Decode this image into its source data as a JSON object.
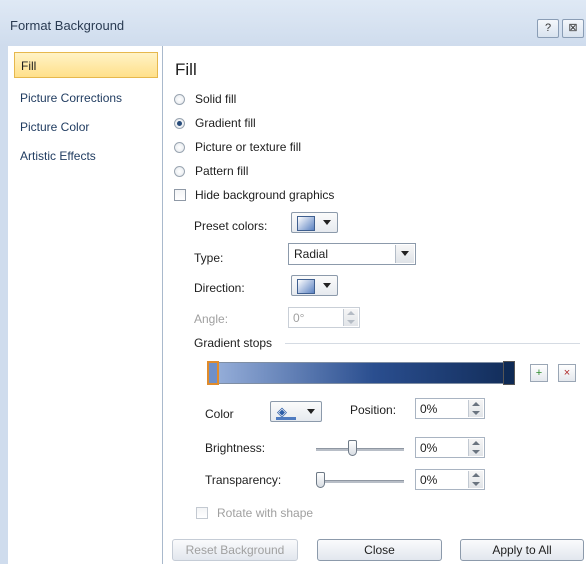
{
  "window": {
    "title": "Format Background",
    "help_label": "?",
    "close_label": "⊠"
  },
  "sidebar": {
    "items": [
      {
        "label": "Fill",
        "selected": true
      },
      {
        "label": "Picture Corrections"
      },
      {
        "label": "Picture Color"
      },
      {
        "label": "Artistic Effects"
      }
    ]
  },
  "fill": {
    "heading": "Fill",
    "options": [
      {
        "label": "Solid fill",
        "checked": false
      },
      {
        "label": "Gradient fill",
        "checked": true
      },
      {
        "label": "Picture or texture fill",
        "checked": false
      },
      {
        "label": "Pattern fill",
        "checked": false
      }
    ],
    "hide_background_label": "Hide background graphics",
    "preset_colors_label": "Preset colors:",
    "type_label": "Type:",
    "type_value": "Radial",
    "direction_label": "Direction:",
    "angle_label": "Angle:",
    "angle_value": "0°",
    "gradient_stops_label": "Gradient stops",
    "color_label": "Color",
    "position_label": "Position:",
    "position_value": "0%",
    "brightness_label": "Brightness:",
    "brightness_value": "0%",
    "transparency_label": "Transparency:",
    "transparency_value": "0%",
    "rotate_label": "Rotate with shape"
  },
  "footer": {
    "reset_label": "Reset Background",
    "close_label": "Close",
    "apply_label": "Apply to All"
  },
  "colors": {
    "accent": "#274b7a",
    "selection": "#ffe08a"
  }
}
